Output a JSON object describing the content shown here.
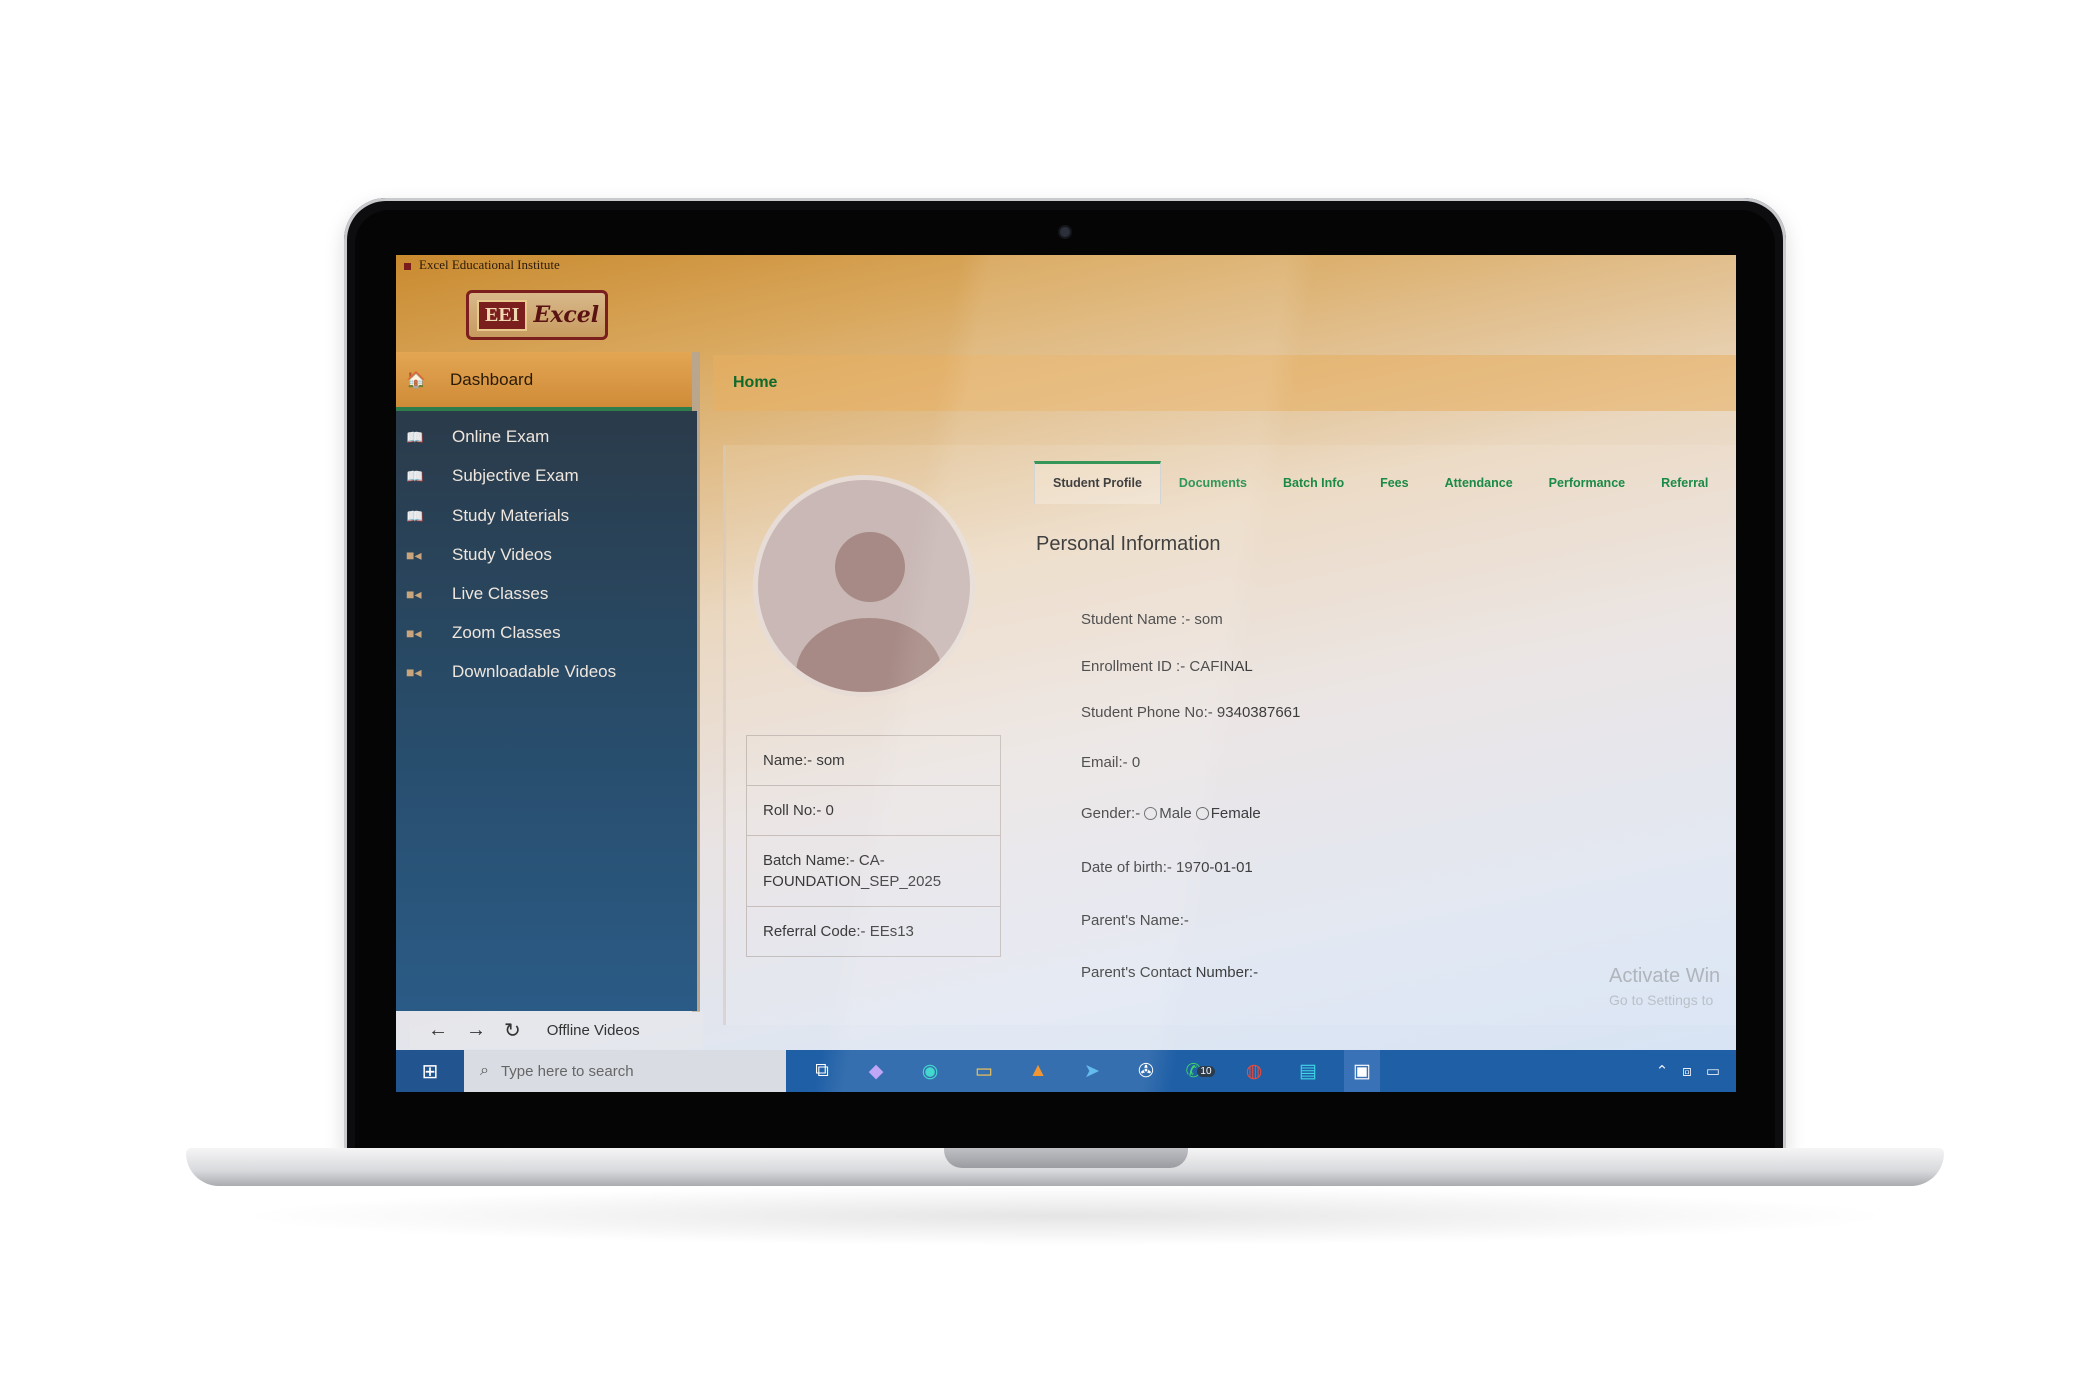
{
  "window": {
    "title": "Excel Educational Institute"
  },
  "logo": {
    "monogram": "EEI",
    "wordmark": "Excel"
  },
  "sidebar": {
    "dashboard_label": "Dashboard",
    "items": [
      {
        "label": "Online Exam",
        "icon": "book-icon"
      },
      {
        "label": "Subjective Exam",
        "icon": "book-icon"
      },
      {
        "label": "Study Materials",
        "icon": "book-icon"
      },
      {
        "label": "Study Videos",
        "icon": "video-camera-icon"
      },
      {
        "label": "Live Classes",
        "icon": "video-camera-icon"
      },
      {
        "label": "Zoom Classes",
        "icon": "video-camera-icon"
      },
      {
        "label": "Downloadable Videos",
        "icon": "video-camera-icon"
      }
    ]
  },
  "header": {
    "breadcrumb": "Home"
  },
  "profile_card": {
    "name": "Name:- som",
    "roll": "Roll No:- 0",
    "batch": "Batch Name:- CA-FOUNDATION_SEP_2025",
    "referral": "Referral Code:- EEs13"
  },
  "tabs": [
    "Student Profile",
    "Documents",
    "Batch Info",
    "Fees",
    "Attendance",
    "Performance",
    "Referral"
  ],
  "personal_info": {
    "title": "Personal Information",
    "student_name": "Student Name :- som",
    "enrollment": "Enrollment ID :- CAFINAL",
    "phone": "Student Phone No:- 9340387661",
    "email": "Email:- 0",
    "gender_label": "Gender:-",
    "gender_options": [
      "Male",
      "Female"
    ],
    "dob": "Date of birth:- 1970-01-01",
    "parent_name": "Parent's Name:-",
    "parent_contact": "Parent's Contact Number:-"
  },
  "watermark": {
    "line1": "Activate Win",
    "line2": "Go to Settings to"
  },
  "browser_nav": {
    "label": "Offline Videos"
  },
  "taskbar": {
    "search_placeholder": "Type here to search",
    "badge": "10"
  }
}
